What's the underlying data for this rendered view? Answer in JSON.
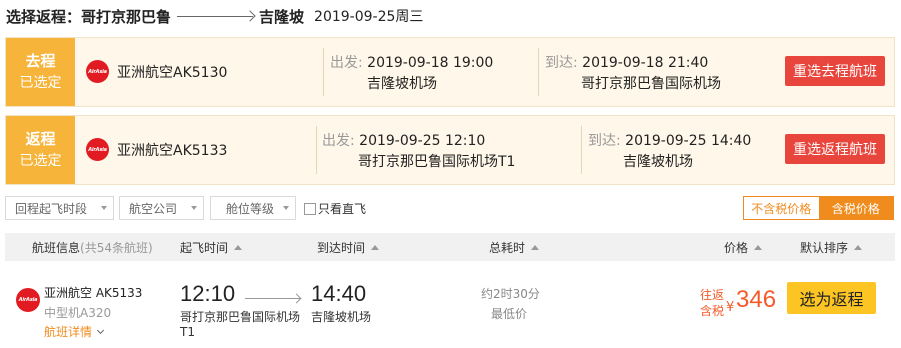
{
  "header": {
    "label": "选择返程：",
    "from": "哥打京那巴鲁",
    "to": "吉隆坡",
    "date": "2019-09-25周三"
  },
  "outbound": {
    "tag_title": "去程",
    "tag_status": "已选定",
    "airline_logo": "AirAsia",
    "flight": "亚洲航空AK5130",
    "dep_label": "出发:",
    "dep_datetime": "2019-09-18 19:00",
    "dep_airport": "吉隆坡机场",
    "arr_label": "到达:",
    "arr_datetime": "2019-09-18 21:40",
    "arr_airport": "哥打京那巴鲁国际机场",
    "reselect": "重选去程航班"
  },
  "return": {
    "tag_title": "返程",
    "tag_status": "已选定",
    "airline_logo": "AirAsia",
    "flight": "亚洲航空AK5133",
    "dep_label": "出发:",
    "dep_datetime": "2019-09-25 12:10",
    "dep_airport": "哥打京那巴鲁国际机场T1",
    "arr_label": "到达:",
    "arr_datetime": "2019-09-25 14:40",
    "arr_airport": "吉隆坡机场",
    "reselect": "重选返程航班"
  },
  "filters": {
    "time": "回程起飞时段",
    "airline": "航空公司",
    "cabin": "舱位等级",
    "direct_only": "只看直飞",
    "price_no_tax": "不含税价格",
    "price_with_tax": "含税价格"
  },
  "table_header": {
    "flight_info": "航班信息",
    "flight_count": "(共54条航班)",
    "dep_time": "起飞时间",
    "arr_time": "到达时间",
    "duration": "总耗时",
    "price": "价格",
    "sort": "默认排序"
  },
  "flights": [
    {
      "airline_logo": "AirAsia",
      "airline": "亚洲航空 AK5133",
      "aircraft": "中型机A320",
      "detail": "航班详情",
      "dep_time": "12:10",
      "dep_airport": "哥打京那巴鲁国际机场",
      "dep_terminal": "T1",
      "arr_time": "14:40",
      "arr_airport": "吉隆坡机场",
      "duration": "约2时30分",
      "tag": "最低价",
      "price_label_1": "往返",
      "price_label_2": "含税",
      "currency": "¥",
      "price": "346",
      "book": "选为返程"
    }
  ],
  "colors": {
    "tag_bg": "#f7b43a",
    "card_bg": "#fff8ea",
    "reselect_btn": "#e8453c",
    "price": "#f45a2a",
    "book_btn": "#fcc524",
    "toggle_accent": "#f08c1e",
    "airline_logo": "#e21b23",
    "link_orange": "#f08c1e"
  }
}
